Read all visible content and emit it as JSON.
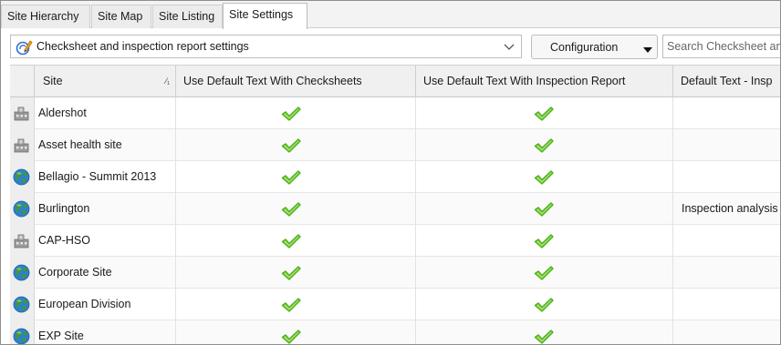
{
  "tabs": [
    {
      "label": "Site Hierarchy",
      "active": false
    },
    {
      "label": "Site Map",
      "active": false
    },
    {
      "label": "Site Listing",
      "active": false
    },
    {
      "label": "Site Settings",
      "active": true
    }
  ],
  "toolbar": {
    "settings_selector": {
      "value": "Checksheet and inspection report settings",
      "icon": "settings-edit-icon"
    },
    "configuration_button": "Configuration",
    "search_placeholder": "Search Checksheet and inspection report settings"
  },
  "grid": {
    "columns": [
      {
        "label": "",
        "key": "type_icon"
      },
      {
        "label": "Site",
        "key": "site",
        "sort": "⁄₁"
      },
      {
        "label": "Use Default Text With Checksheets",
        "key": "default_checksheets"
      },
      {
        "label": "Use Default Text With Inspection Report",
        "key": "default_inspection"
      },
      {
        "label": "Default Text - Insp",
        "key": "default_text"
      }
    ],
    "rows": [
      {
        "icon": "building-icon",
        "site": "Aldershot",
        "default_checksheets": true,
        "default_inspection": true,
        "default_text": ""
      },
      {
        "icon": "building-icon",
        "site": "Asset health site",
        "default_checksheets": true,
        "default_inspection": true,
        "default_text": ""
      },
      {
        "icon": "globe-icon",
        "site": "Bellagio - Summit 2013",
        "default_checksheets": true,
        "default_inspection": true,
        "default_text": ""
      },
      {
        "icon": "globe-icon",
        "site": "Burlington",
        "default_checksheets": true,
        "default_inspection": true,
        "default_text": "Inspection analysis"
      },
      {
        "icon": "building-icon",
        "site": "CAP-HSO",
        "default_checksheets": true,
        "default_inspection": true,
        "default_text": ""
      },
      {
        "icon": "globe-icon",
        "site": "Corporate Site",
        "default_checksheets": true,
        "default_inspection": true,
        "default_text": ""
      },
      {
        "icon": "globe-icon",
        "site": "European Division",
        "default_checksheets": true,
        "default_inspection": true,
        "default_text": ""
      },
      {
        "icon": "globe-icon",
        "site": "EXP Site",
        "default_checksheets": true,
        "default_inspection": true,
        "default_text": ""
      }
    ]
  },
  "colors": {
    "check": "#4caf1c",
    "check_light": "#9ee066",
    "globe_land": "#3f9a2e",
    "globe_sea": "#2e7fd0",
    "building": "#9a9a9a"
  }
}
